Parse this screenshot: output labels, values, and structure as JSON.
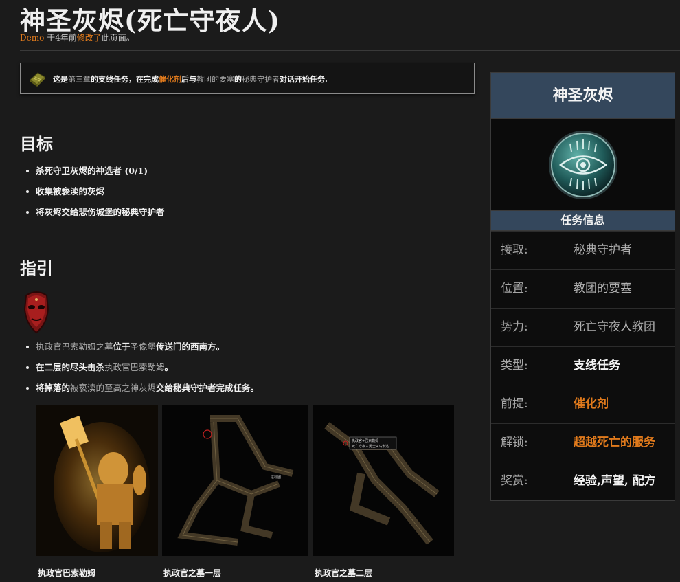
{
  "page": {
    "title": "神圣灰烬(死亡守夜人)",
    "author": "Demo",
    "edit_prefix": " 于4年前",
    "edit_link": "修改了",
    "edit_suffix": "此页面。"
  },
  "notice": {
    "p1": "这是",
    "p2": "第三章",
    "p3": "的支线任务，在完成",
    "p4": "催化剂",
    "p5": "后与",
    "p6": "教团的要塞",
    "p7": "的",
    "p8": "秘典守护者",
    "p9": "对话开始任务."
  },
  "objectives": {
    "heading": "目标",
    "items": [
      "杀死守卫灰烬的神选者 (0/1)",
      "收集被亵渎的灰烬",
      "将灰烬交给悲伤城堡的秘典守护者"
    ]
  },
  "guide": {
    "heading": "指引",
    "item1": {
      "a": "执政官巴索勒姆之墓",
      "b": "位于",
      "c": "圣像堡",
      "d": "传送门的西南方。"
    },
    "item2": {
      "a": "在二层的尽头击杀",
      "b": "执政官巴索勒姆",
      "c": "。"
    },
    "item3": {
      "a": "将掉落的",
      "b": "被亵渎的至高之神灰烬",
      "c": "交给秘典守护者完成任务。"
    }
  },
  "gallery": [
    {
      "caption": "执政官巴索勒姆"
    },
    {
      "caption": "执政官之墓一层"
    },
    {
      "caption": "执政官之墓二层"
    }
  ],
  "map_labels": {
    "m1_tag": "达标图",
    "m2_line1": "执政官+巴索勒姆",
    "m2_line2": "死亡守夜人勇士+马卡达"
  },
  "infobox": {
    "title": "神圣灰烬",
    "subtitle": "任务信息",
    "rows": [
      {
        "key": "接取:",
        "value": "秘典守护者"
      },
      {
        "key": "位置:",
        "value": "教团的要塞"
      },
      {
        "key": "势力:",
        "value": "死亡守夜人教团"
      },
      {
        "key": "类型:",
        "value": "支线任务"
      },
      {
        "key": "前提:",
        "value": "催化剂"
      },
      {
        "key": "解锁:",
        "value": "超越死亡的服务"
      },
      {
        "key": "奖赏:",
        "value": "经验,声望, 配方"
      }
    ]
  },
  "colors": {
    "accent_orange": "#e07a1c",
    "infobox_header": "#34475c",
    "background": "#1b1b1b"
  },
  "icons": {
    "notice": "book-icon",
    "guide": "mask-icon",
    "quest": "eye-emblem-icon"
  }
}
